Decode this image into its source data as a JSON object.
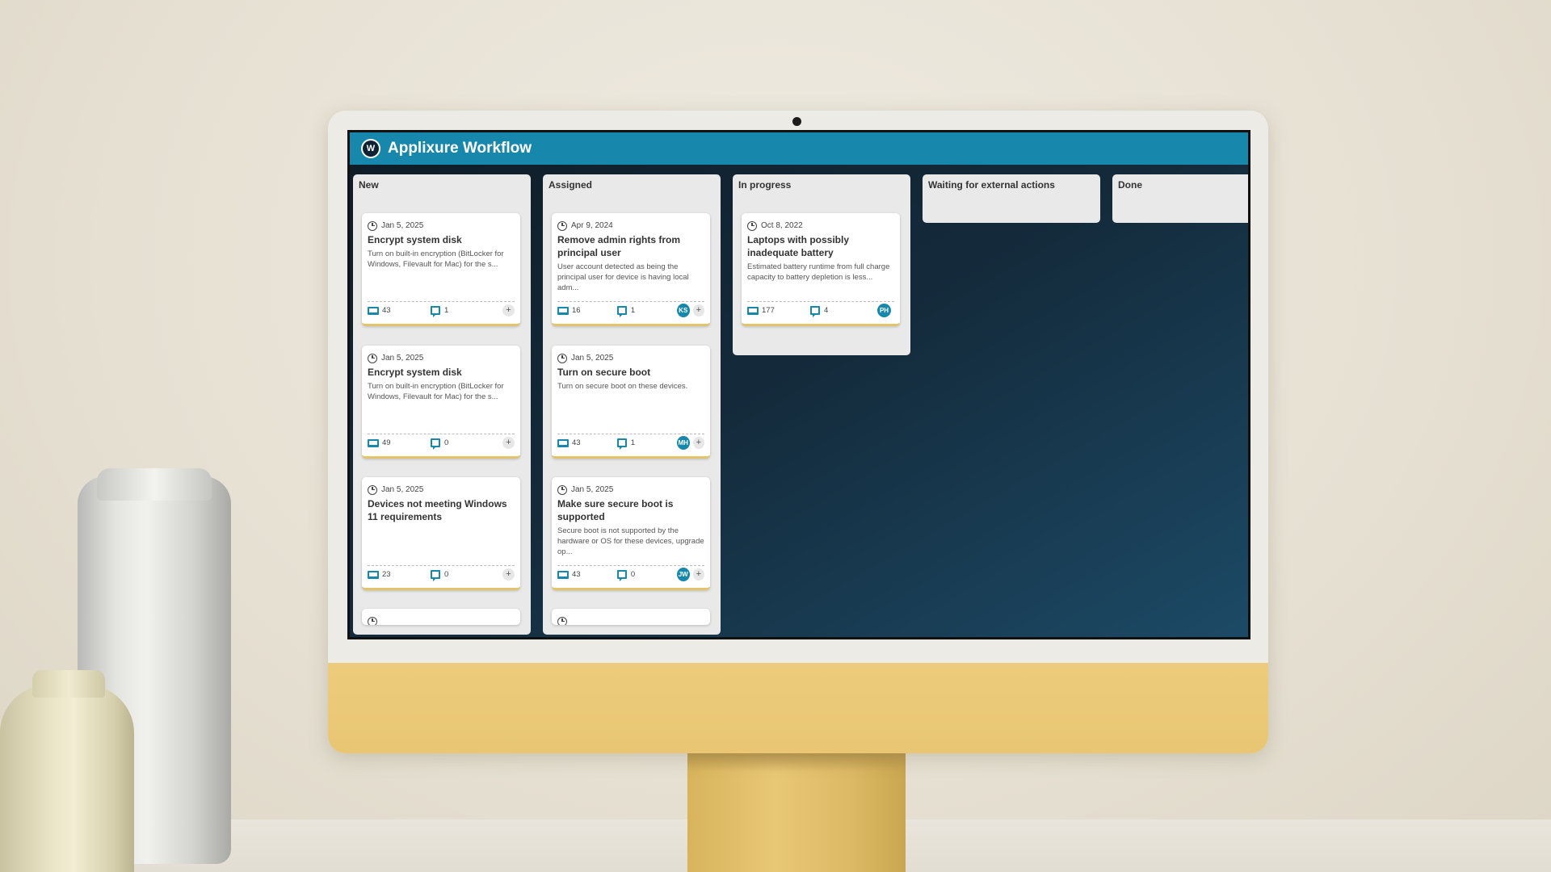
{
  "app": {
    "title": "Applixure Workflow",
    "logo_glyph": "W",
    "header_color": "#1787ab"
  },
  "columns": [
    {
      "title": "New",
      "cards": [
        {
          "date": "Jan 5, 2025",
          "title": "Encrypt system disk",
          "description": "Turn on built-in encryption (BitLocker for Windows, Filevault for Mac) for the s...",
          "devices": "43",
          "comments": "1",
          "assignee": ""
        },
        {
          "date": "Jan 5, 2025",
          "title": "Encrypt system disk",
          "description": "Turn on built-in encryption (BitLocker for Windows, Filevault for Mac) for the s...",
          "devices": "49",
          "comments": "0",
          "assignee": ""
        },
        {
          "date": "Jan 5, 2025",
          "title": "Devices not meeting Windows 11 requirements",
          "description": "",
          "devices": "23",
          "comments": "0",
          "assignee": ""
        }
      ]
    },
    {
      "title": "Assigned",
      "cards": [
        {
          "date": "Apr 9, 2024",
          "title": "Remove admin rights from principal user",
          "description": "User account detected as being the principal user for device is having local adm...",
          "devices": "16",
          "comments": "1",
          "assignee": "KS"
        },
        {
          "date": "Jan 5, 2025",
          "title": "Turn on secure boot",
          "description": "Turn on secure boot on these devices.",
          "devices": "43",
          "comments": "1",
          "assignee": "MH"
        },
        {
          "date": "Jan 5, 2025",
          "title": "Make sure secure boot is supported",
          "description": "Secure boot is not supported by the hardware or OS for these devices, upgrade op...",
          "devices": "43",
          "comments": "0",
          "assignee": "JW"
        }
      ]
    },
    {
      "title": "In progress",
      "cards": [
        {
          "date": "Oct 8, 2022",
          "title": "Laptops with possibly inadequate battery",
          "description": "Estimated battery runtime from full charge capacity to battery depletion is less...",
          "devices": "177",
          "comments": "4",
          "assignee": "PH"
        }
      ]
    },
    {
      "title": "Waiting for external actions",
      "cards": []
    },
    {
      "title": "Done",
      "cards": []
    }
  ],
  "add_label": "+",
  "icons": {
    "date": "clock-icon",
    "devices": "laptop-icon",
    "comments": "comment-icon",
    "add": "plus-icon"
  }
}
